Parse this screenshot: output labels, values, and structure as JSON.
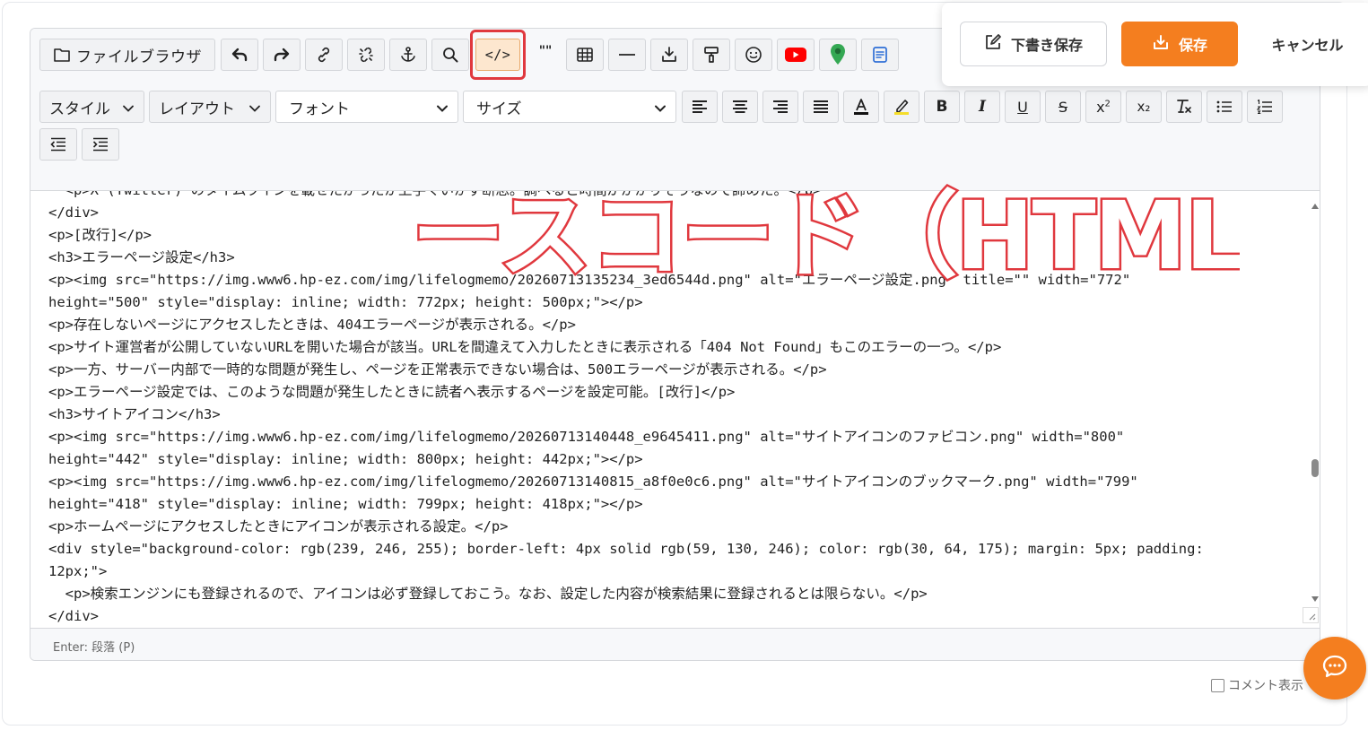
{
  "toolbar": {
    "file_browser_label": "ファイルブラウザ",
    "style_label": "スタイル",
    "layout_label": "レイアウト",
    "font_label": "フォント",
    "size_label": "サイズ",
    "source_button_label": "</>",
    "quote_label": "\"\"",
    "subscript_label": "x₂",
    "underline_label": "U",
    "strike_label": "S",
    "bold_label": "B",
    "italic_label": "I"
  },
  "code_lines": [
    "  <p>X (Twitter) のタイムラインを載せたかったが上手くいかず断念。調べると時間がかかりそうなので諦めた。</p>",
    "</div>",
    "<p>[改行]</p>",
    "<h3>エラーページ設定</h3>",
    "<p><img src=\"https://img.www6.hp-ez.com/img/lifelogmemo/20260713135234_3ed6544d.png\" alt=\"エラーページ設定.png\" title=\"\" width=\"772\"",
    "height=\"500\" style=\"display: inline; width: 772px; height: 500px;\"></p>",
    "<p>存在しないページにアクセスしたときは、404エラーページが表示される。</p>",
    "<p>サイト運営者が公開していないURLを開いた場合が該当。URLを間違えて入力したときに表示される「404 Not Found」もこのエラーの一つ。</p>",
    "<p>一方、サーバー内部で一時的な問題が発生し、ページを正常表示できない場合は、500エラーページが表示される。</p>",
    "<p>エラーページ設定では、このような問題が発生したときに読者へ表示するページを設定可能。[改行]</p>",
    "<h3>サイトアイコン</h3>",
    "<p><img src=\"https://img.www6.hp-ez.com/img/lifelogmemo/20260713140448_e9645411.png\" alt=\"サイトアイコンのファビコン.png\" width=\"800\"",
    "height=\"442\" style=\"display: inline; width: 800px; height: 442px;\"></p>",
    "<p><img src=\"https://img.www6.hp-ez.com/img/lifelogmemo/20260713140815_a8f0e0c6.png\" alt=\"サイトアイコンのブックマーク.png\" width=\"799\"",
    "height=\"418\" style=\"display: inline; width: 799px; height: 418px;\"></p>",
    "<p>ホームページにアクセスしたときにアイコンが表示される設定。</p>",
    "<div style=\"background-color: rgb(239, 246, 255); border-left: 4px solid rgb(59, 130, 246); color: rgb(30, 64, 175); margin: 5px; padding:",
    "12px;\">",
    "  <p>検索エンジンにも登録されるので、アイコンは必ず登録しておこう。なお、設定した内容が検索結果に登録されるとは限らない。</p>",
    "</div>"
  ],
  "status": {
    "hint": "Enter: 段落 (P)"
  },
  "overlay": {
    "title": "ソースコード（HTML）"
  },
  "actions": {
    "draft_label": "下書き保存",
    "save_label": "保存",
    "cancel_label": "キャンセル"
  },
  "comment_toggle_label": "コメント表示",
  "colors": {
    "accent": "#f47e1f",
    "highlight": "#e0383e",
    "youtube": "#ff0000",
    "map_pin": "#34a853",
    "note": "#2f6fd6"
  }
}
